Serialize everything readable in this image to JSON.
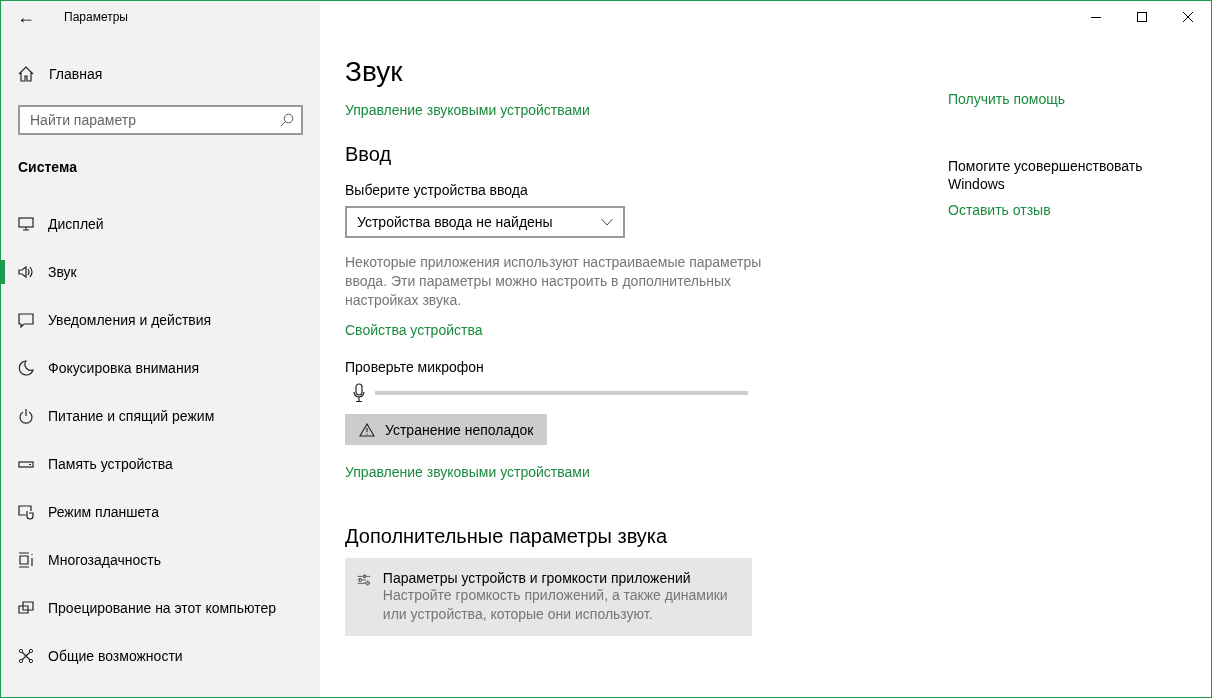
{
  "window": {
    "title": "Параметры",
    "back": "←"
  },
  "sidebar": {
    "home": "Главная",
    "search": {
      "placeholder": "Найти параметр"
    },
    "section": "Система",
    "items": [
      {
        "label": "Дисплей",
        "selected": false
      },
      {
        "label": "Звук",
        "selected": true
      },
      {
        "label": "Уведомления и действия",
        "selected": false
      },
      {
        "label": "Фокусировка внимания",
        "selected": false
      },
      {
        "label": "Питание и спящий режим",
        "selected": false
      },
      {
        "label": "Память устройства",
        "selected": false
      },
      {
        "label": "Режим планшета",
        "selected": false
      },
      {
        "label": "Многозадачность",
        "selected": false
      },
      {
        "label": "Проецирование на этот компьютер",
        "selected": false
      },
      {
        "label": "Общие возможности",
        "selected": false
      }
    ]
  },
  "main": {
    "title": "Звук",
    "top_link": "Управление звуковыми устройствами",
    "input": {
      "heading": "Ввод",
      "select_label": "Выберите устройства ввода",
      "select_value": "Устройства ввода не найдены",
      "description": "Некоторые приложения используют настраиваемые параметры ввода. Эти параметры можно настроить в дополнительных настройках звука.",
      "properties_link": "Свойства устройства",
      "mic_label": "Проверьте микрофон",
      "mic_level": {
        "level": 0
      },
      "troubleshoot_button": "Устранение неполадок",
      "manage_link": "Управление звуковыми устройствами"
    },
    "advanced": {
      "heading": "Дополнительные параметры звука",
      "card_title": "Параметры устройств и громкости приложений",
      "card_description": "Настройте громкость приложений, а также динамики или устройства, которые они используют."
    }
  },
  "right": {
    "help_link": "Получить помощь",
    "improve_text": "Помогите усовершенствовать Windows",
    "feedback_link": "Оставить отзыв"
  }
}
